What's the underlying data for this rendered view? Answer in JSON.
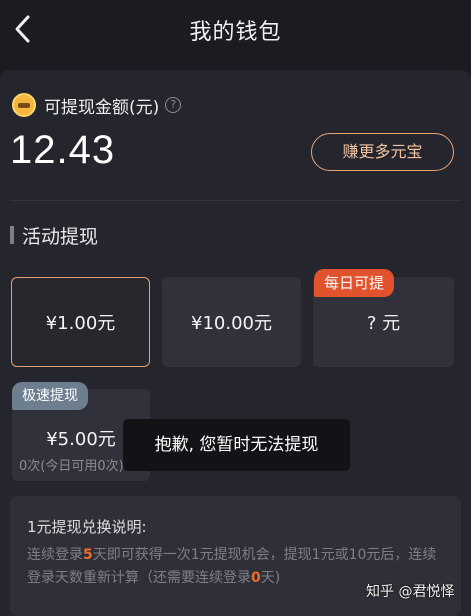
{
  "header": {
    "title": "我的钱包"
  },
  "wallet": {
    "balance_label": "可提现金额(元)",
    "balance": "12.43",
    "earn_button": "赚更多元宝"
  },
  "activity": {
    "section_title": "活动提现",
    "options": [
      {
        "label": "¥1.00元",
        "selected": true
      },
      {
        "label": "¥10.00元",
        "selected": false
      },
      {
        "label": "? 元",
        "badge": "每日可提",
        "selected": false
      },
      {
        "label": "¥5.00元",
        "badge": "极速提现",
        "sub": "0次(今日可用0次)",
        "selected": false
      }
    ]
  },
  "toast": {
    "message": "抱歉, 您暂时无法提现"
  },
  "info": {
    "title": "1元提现兑换说明:",
    "text_1": "连续登录",
    "days_required": "5",
    "text_2": "天即可获得一次1元提现机会，提现1元或10元后，连续登录天数重新计算（还需要连续登录",
    "days_remaining": "0",
    "text_3": "天)"
  },
  "watermark": {
    "text": "知乎 @君悦怿"
  },
  "colors": {
    "background": "#1b1c22",
    "card": "#25262d",
    "accent": "#e1a273",
    "badge_orange": "#e0532c",
    "badge_gray": "#6c7e8f",
    "highlight": "#f06b2a"
  }
}
